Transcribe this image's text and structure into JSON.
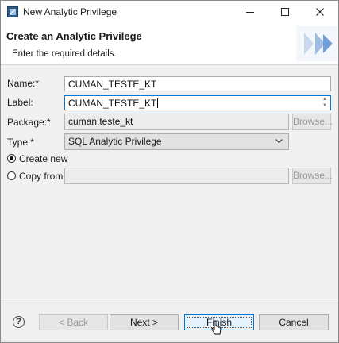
{
  "window": {
    "title": "New Analytic Privilege",
    "controls": {
      "minimize": "—",
      "maximize": "☐",
      "close": "✕"
    }
  },
  "banner": {
    "title": "Create an Analytic Privilege",
    "subtitle": "Enter the required details."
  },
  "form": {
    "name": {
      "label": "Name:*",
      "value": "CUMAN_TESTE_KT"
    },
    "label_field": {
      "label": "Label:",
      "value": "CUMAN_TESTE_KT"
    },
    "package": {
      "label": "Package:*",
      "value": "cuman.teste_kt",
      "browse_label": "Browse..."
    },
    "type": {
      "label": "Type:*",
      "value": "SQL Analytic Privilege"
    },
    "create_new": {
      "label": "Create new",
      "checked": true
    },
    "copy_from": {
      "label": "Copy from",
      "value": "",
      "browse_label": "Browse..."
    }
  },
  "footer": {
    "help_glyph": "?",
    "back_label": "< Back",
    "next_label": "Next >",
    "finish_label": "Finish",
    "cancel_label": "Cancel"
  },
  "colors": {
    "accent": "#0078d7",
    "banner_graphic": "#c9d8ec"
  }
}
